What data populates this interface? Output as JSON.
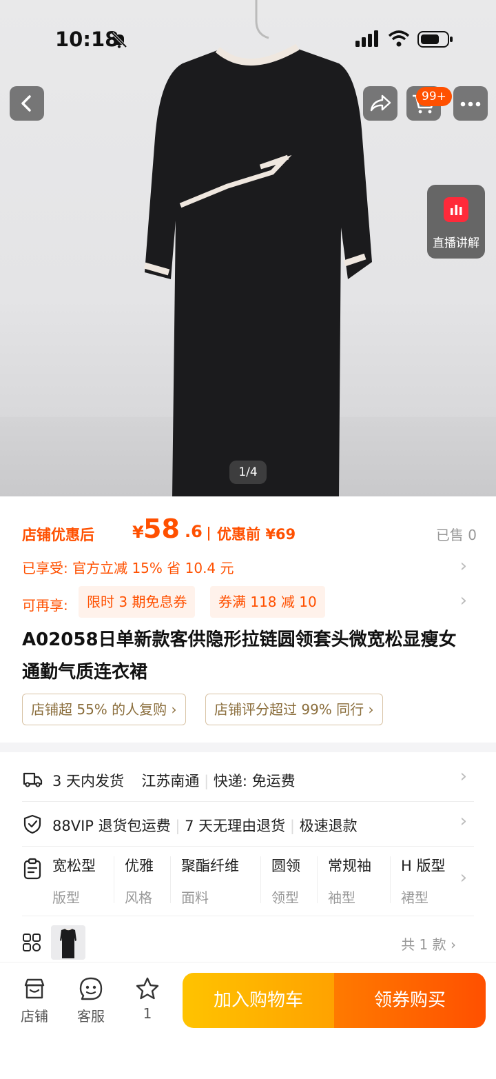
{
  "status": {
    "time": "10:18"
  },
  "cart_badge": "99+",
  "live": {
    "label": "直播讲解"
  },
  "gallery": {
    "pager": "1/4"
  },
  "price": {
    "after_label": "店铺优惠后",
    "currency": "¥",
    "integer": "58",
    "decimal": ".6",
    "before_label": "优惠前",
    "before_value": "¥69",
    "sold": "已售 0"
  },
  "enjoyed": "已享受: 官方立减 15% 省 10.4 元",
  "more_coupons": {
    "lead": "可再享:",
    "items": [
      "限时 3 期免息券",
      "券满 118 减 10"
    ]
  },
  "product": {
    "title": "A02058日单新款客供隐形拉链圆领套头微宽松显瘦女通勤气质连衣裙"
  },
  "pills": [
    "店铺超 55% 的人复购 ›",
    "店铺评分超过 99% 同行 ›"
  ],
  "shipping": {
    "items": [
      "3 天内发货",
      "江苏南通",
      "快递: 免运费"
    ]
  },
  "service": {
    "items": [
      "88VIP 退货包运费",
      "7 天无理由退货",
      "极速退款"
    ]
  },
  "attributes": [
    {
      "value": "宽松型",
      "key": "版型"
    },
    {
      "value": "优雅",
      "key": "风格"
    },
    {
      "value": "聚酯纤维",
      "key": "面料"
    },
    {
      "value": "圆领",
      "key": "领型"
    },
    {
      "value": "常规袖",
      "key": "袖型"
    },
    {
      "value": "H 版型",
      "key": "裙型"
    }
  ],
  "variants": {
    "count": "共 1 款 ›"
  },
  "bottom": {
    "store": "店铺",
    "service": "客服",
    "fav_count": "1",
    "add_cart": "加入购物车",
    "buy": "领券购买"
  },
  "colors": {
    "accent": "#ff5000",
    "gold": "#ffa200"
  }
}
